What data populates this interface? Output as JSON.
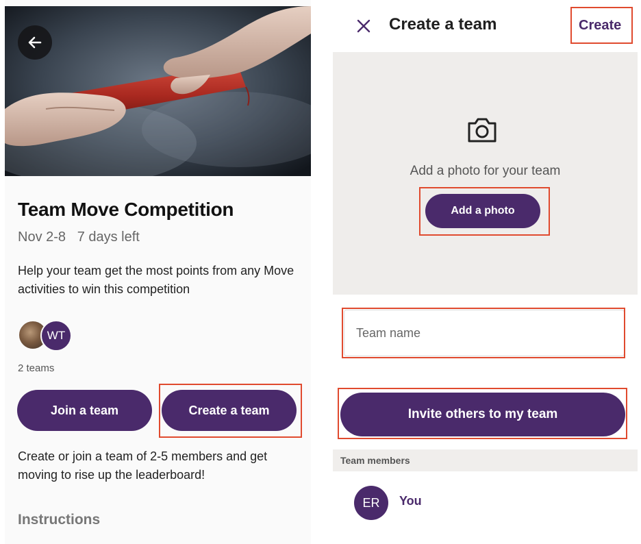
{
  "colors": {
    "brand_purple": "#4a2a6b",
    "highlight_red": "#e04a2e",
    "photo_area_bg": "#efedeb"
  },
  "competition": {
    "back_icon": "arrow-left-icon",
    "hero_image": "relay-baton-handoff",
    "title": "Team Move Competition",
    "dates": "Nov 2-8   7 days left",
    "description": "Help your team get the most points from any Move activities to win this competition",
    "avatar_initials": "WT",
    "team_count": "2 teams",
    "join_label": "Join a team",
    "create_label": "Create a team",
    "help_text": "Create or join a team of 2-5 members and get moving to rise up the leaderboard!",
    "instructions_heading": "Instructions"
  },
  "create_team": {
    "close_icon": "close-icon",
    "title": "Create a team",
    "create_label": "Create",
    "camera_icon": "camera-icon",
    "photo_prompt": "Add a photo for your team",
    "add_photo_label": "Add a photo",
    "team_name_placeholder": "Team name",
    "team_name_value": "",
    "invite_label": "Invite others to my team",
    "members_heading": "Team members",
    "members": [
      {
        "initials": "ER",
        "name": "You"
      }
    ]
  }
}
